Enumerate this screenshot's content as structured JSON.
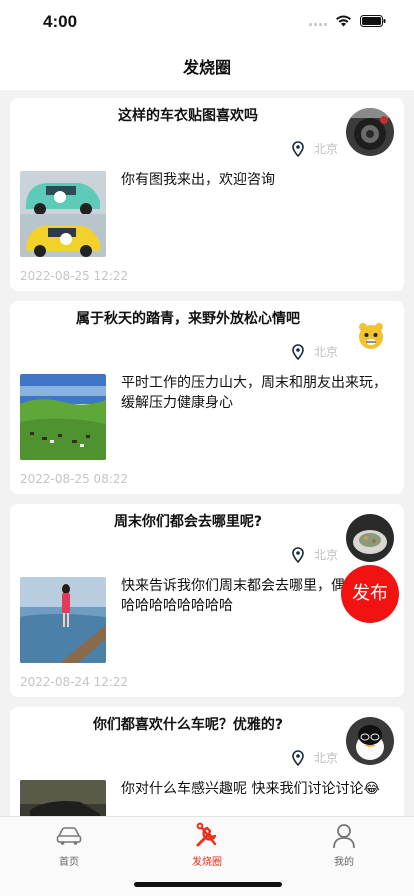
{
  "status": {
    "time": "4:00"
  },
  "nav": {
    "title": "发烧圈"
  },
  "posts": [
    {
      "title": "这样的车衣贴图喜欢吗",
      "location": "北京",
      "description": "你有图我来出，欢迎咨询",
      "time": "2022-08-25 12:22"
    },
    {
      "title": "属于秋天的踏青，来野外放松心情吧",
      "location": "北京",
      "description": "平时工作的压力山大，周末和朋友出来玩，缓解压力健康身心",
      "time": "2022-08-25 08:22"
    },
    {
      "title": "周末你们都会去哪里呢?",
      "location": "北京",
      "description": "快来告诉我你们周末都会去哪里，偶遇吧哈哈哈哈哈哈哈哈哈",
      "time": "2022-08-24 12:22"
    },
    {
      "title": "你们都喜欢什么车呢？优雅的?",
      "location": "北京",
      "description": "你对什么车感兴趣呢 快来我们讨论讨论😂"
    }
  ],
  "fab": {
    "label": "发布"
  },
  "tabs": [
    {
      "label": "首页",
      "icon": "car-icon"
    },
    {
      "label": "发烧圈",
      "icon": "wrench-icon",
      "active": true
    },
    {
      "label": "我的",
      "icon": "person-icon"
    }
  ],
  "colors": {
    "accent": "#f31212",
    "active_tab": "#e8301c",
    "muted": "#c0c0c0"
  }
}
